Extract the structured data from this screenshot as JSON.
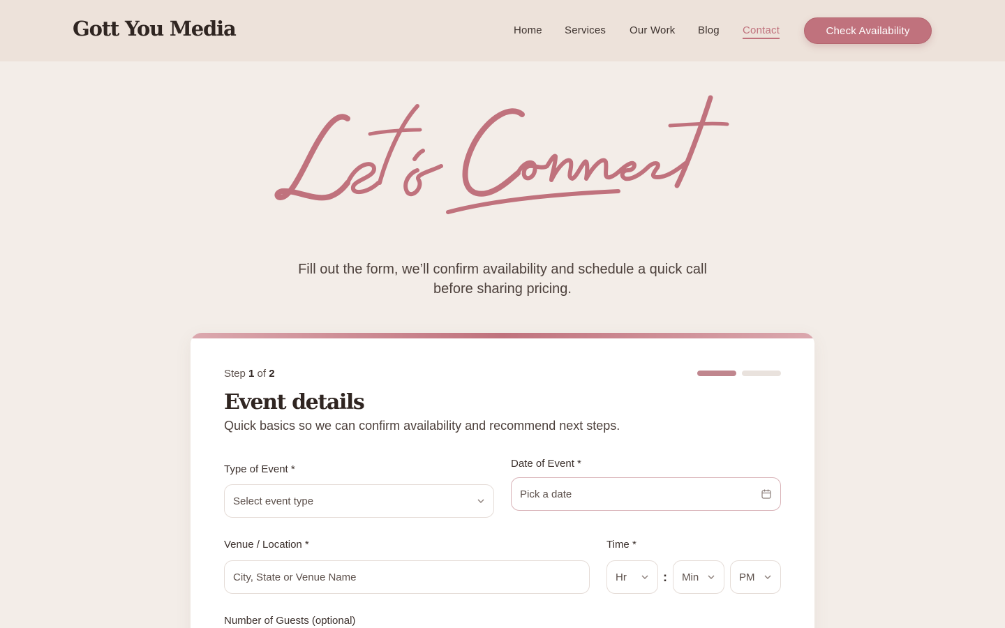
{
  "header": {
    "brand": "Gott You Media",
    "nav": [
      {
        "label": "Home"
      },
      {
        "label": "Services"
      },
      {
        "label": "Our Work"
      },
      {
        "label": "Blog"
      },
      {
        "label": "Contact",
        "active": true
      }
    ],
    "cta_label": "Check Availability"
  },
  "hero": {
    "script_title": "Let's Connect",
    "subtitle": "Fill out the form, we’ll confirm availability and schedule a quick call before sharing pricing."
  },
  "form": {
    "step_prefix": "Step",
    "step_current": "1",
    "step_of": "of",
    "step_total": "2",
    "title": "Event details",
    "subtitle": "Quick basics so we can confirm availability and recommend next steps.",
    "fields": {
      "event_type": {
        "label": "Type of Event *",
        "placeholder": "Select event type"
      },
      "date": {
        "label": "Date of Event *",
        "placeholder": "Pick a date"
      },
      "venue": {
        "label": "Venue / Location *",
        "placeholder": "City, State or Venue Name"
      },
      "time": {
        "label": "Time *",
        "hour": "Hr",
        "separator": ":",
        "minute": "Min",
        "period": "PM"
      },
      "guests": {
        "label": "Number of Guests (optional)"
      }
    }
  },
  "colors": {
    "accent": "#c0727d",
    "header_bg": "#ede2da",
    "page_bg": "#f3ede8"
  },
  "icons": {
    "date": "calendar-icon",
    "dropdown": "chevron-down-icon"
  }
}
